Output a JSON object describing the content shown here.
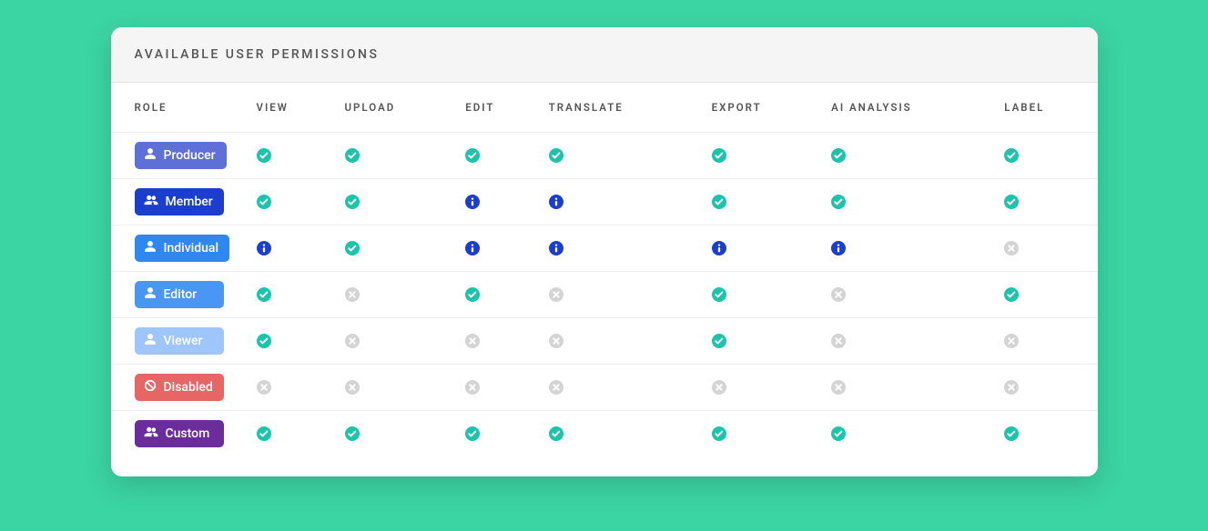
{
  "title": "AVAILABLE USER PERMISSIONS",
  "columns": [
    "ROLE",
    "VIEW",
    "UPLOAD",
    "EDIT",
    "TRANSLATE",
    "EXPORT",
    "AI ANALYSIS",
    "LABEL"
  ],
  "roles": [
    {
      "name": "Producer",
      "icon": "user",
      "color": "#5f6fd8",
      "perms": [
        "check",
        "check",
        "check",
        "check",
        "check",
        "check",
        "check"
      ]
    },
    {
      "name": "Member",
      "icon": "users",
      "color": "#1c3ecf",
      "perms": [
        "check",
        "check",
        "info",
        "info",
        "check",
        "check",
        "check"
      ]
    },
    {
      "name": "Individual",
      "icon": "user",
      "color": "#2f88f0",
      "perms": [
        "info",
        "check",
        "info",
        "info",
        "info",
        "info",
        "cross"
      ]
    },
    {
      "name": "Editor",
      "icon": "user",
      "color": "#4a96f5",
      "perms": [
        "check",
        "cross",
        "check",
        "cross",
        "check",
        "cross",
        "check"
      ]
    },
    {
      "name": "Viewer",
      "icon": "user",
      "color": "#9fc6fb",
      "perms": [
        "check",
        "cross",
        "cross",
        "cross",
        "check",
        "cross",
        "cross"
      ]
    },
    {
      "name": "Disabled",
      "icon": "ban",
      "color": "#e86565",
      "perms": [
        "cross",
        "cross",
        "cross",
        "cross",
        "cross",
        "cross",
        "cross"
      ]
    },
    {
      "name": "Custom",
      "icon": "users",
      "color": "#6b2d9b",
      "perms": [
        "check",
        "check",
        "check",
        "check",
        "check",
        "check",
        "check"
      ]
    }
  ]
}
